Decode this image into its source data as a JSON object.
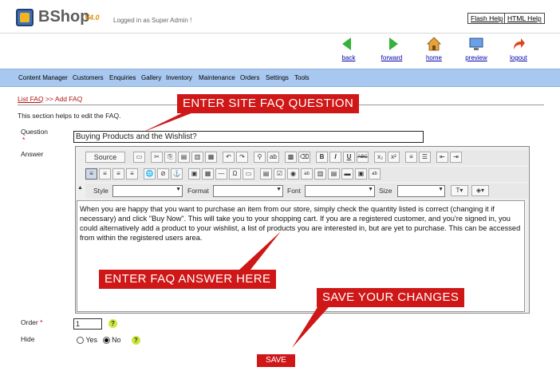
{
  "app": {
    "name": "BShop",
    "version": "V4.0",
    "logged_in": "Logged in as Super Admin !"
  },
  "help": {
    "flash": "Flash Help",
    "html": "HTML Help"
  },
  "tools": [
    {
      "label": "back",
      "icon": "back-arrow-icon"
    },
    {
      "label": "forward",
      "icon": "forward-arrow-icon"
    },
    {
      "label": "home",
      "icon": "home-icon"
    },
    {
      "label": "preview",
      "icon": "preview-icon"
    },
    {
      "label": "logout",
      "icon": "logout-icon"
    }
  ],
  "menu": [
    "Content Manager",
    "Customers",
    "Enquiries",
    "Gallery",
    "Inventory",
    "Maintenance",
    "Orders",
    "Settings",
    "Tools"
  ],
  "breadcrumb": {
    "link": "List FAQ",
    "sep": ">>",
    "current": "Add FAQ"
  },
  "info": "This section helps to edit the FAQ.",
  "form": {
    "question_label": "Question",
    "required_mark": "*",
    "question_value": "Buying Products and the Wishlist?",
    "answer_label": "Answer",
    "answer_text": "When you are happy that you want to purchase an item from our store, simply check the quantity listed is correct (changing it if necessary) and click \"Buy Now\". This will take you to your shopping cart. If you are a registered customer, and you're signed in, you could alternatively add a product to your wishlist, a list of products you are interested in, but are yet to purchase. This can be accessed from within the registered users area.",
    "order_label": "Order",
    "order_value": "1",
    "hide_label": "Hide",
    "hide_yes": "Yes",
    "hide_no": "No",
    "hide_selected": "No",
    "save": "SAVE"
  },
  "editor": {
    "source_label": "Source",
    "style_label": "Style",
    "format_label": "Format",
    "font_label": "Font",
    "size_label": "Size"
  },
  "callouts": {
    "question": "ENTER SITE FAQ QUESTION",
    "answer": "ENTER FAQ ANSWER HERE",
    "save": "SAVE YOUR CHANGES"
  },
  "colors": {
    "menu_bg": "#a9c8ef",
    "callout": "#cf1717",
    "link": "#0000aa"
  }
}
